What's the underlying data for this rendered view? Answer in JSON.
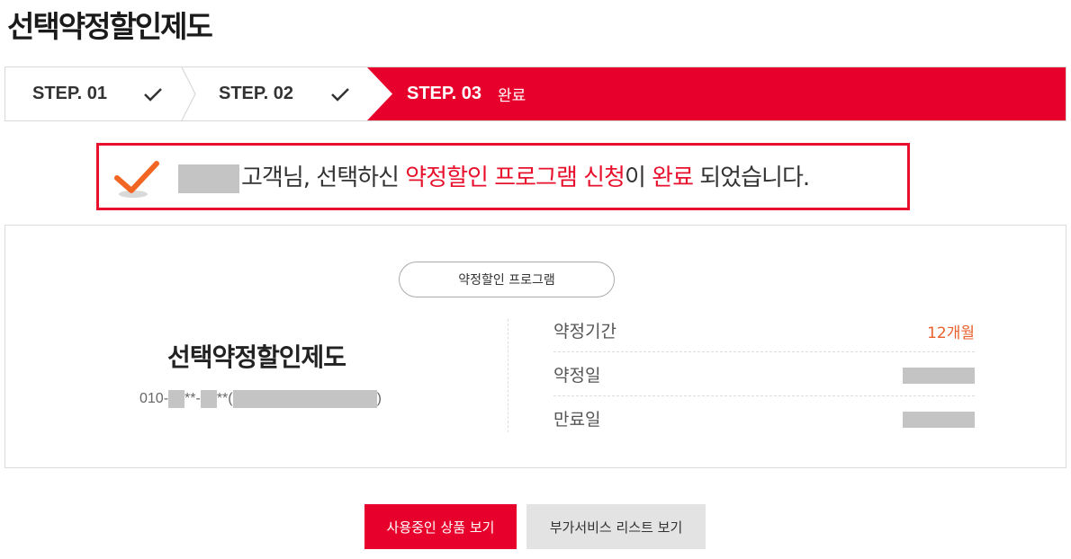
{
  "page": {
    "title": "선택약정할인제도"
  },
  "steps": [
    {
      "label": "STEP. 01",
      "done": true,
      "icon": "check-icon"
    },
    {
      "label": "STEP. 02",
      "done": true,
      "icon": "check-icon"
    },
    {
      "label": "STEP. 03",
      "sub": "완료",
      "active": true
    }
  ],
  "completion": {
    "icon": "check-icon",
    "text_prefix": "고객님, 선택하신 ",
    "highlight_program": "약정할인 프로그램 신청",
    "text_mid": "이 ",
    "highlight_done": "완료",
    "text_suffix": " 되었습니다."
  },
  "card": {
    "program_label": "약정할인 프로그램",
    "plan_name": "선택약정할인제도",
    "phone": {
      "prefix": "010-",
      "sep1": "**-",
      "sep2": "**",
      "open": " (",
      "close": ")"
    },
    "rows": [
      {
        "label": "약정기간",
        "value": "12개월"
      },
      {
        "label": "약정일",
        "value": ""
      },
      {
        "label": "만료일",
        "value": ""
      }
    ]
  },
  "buttons": {
    "primary": "사용중인 상품 보기",
    "secondary": "부가서비스 리스트 보기"
  },
  "colors": {
    "accent": "#e8002d",
    "value_orange": "#e8602d",
    "check_orange": "#f26522"
  }
}
